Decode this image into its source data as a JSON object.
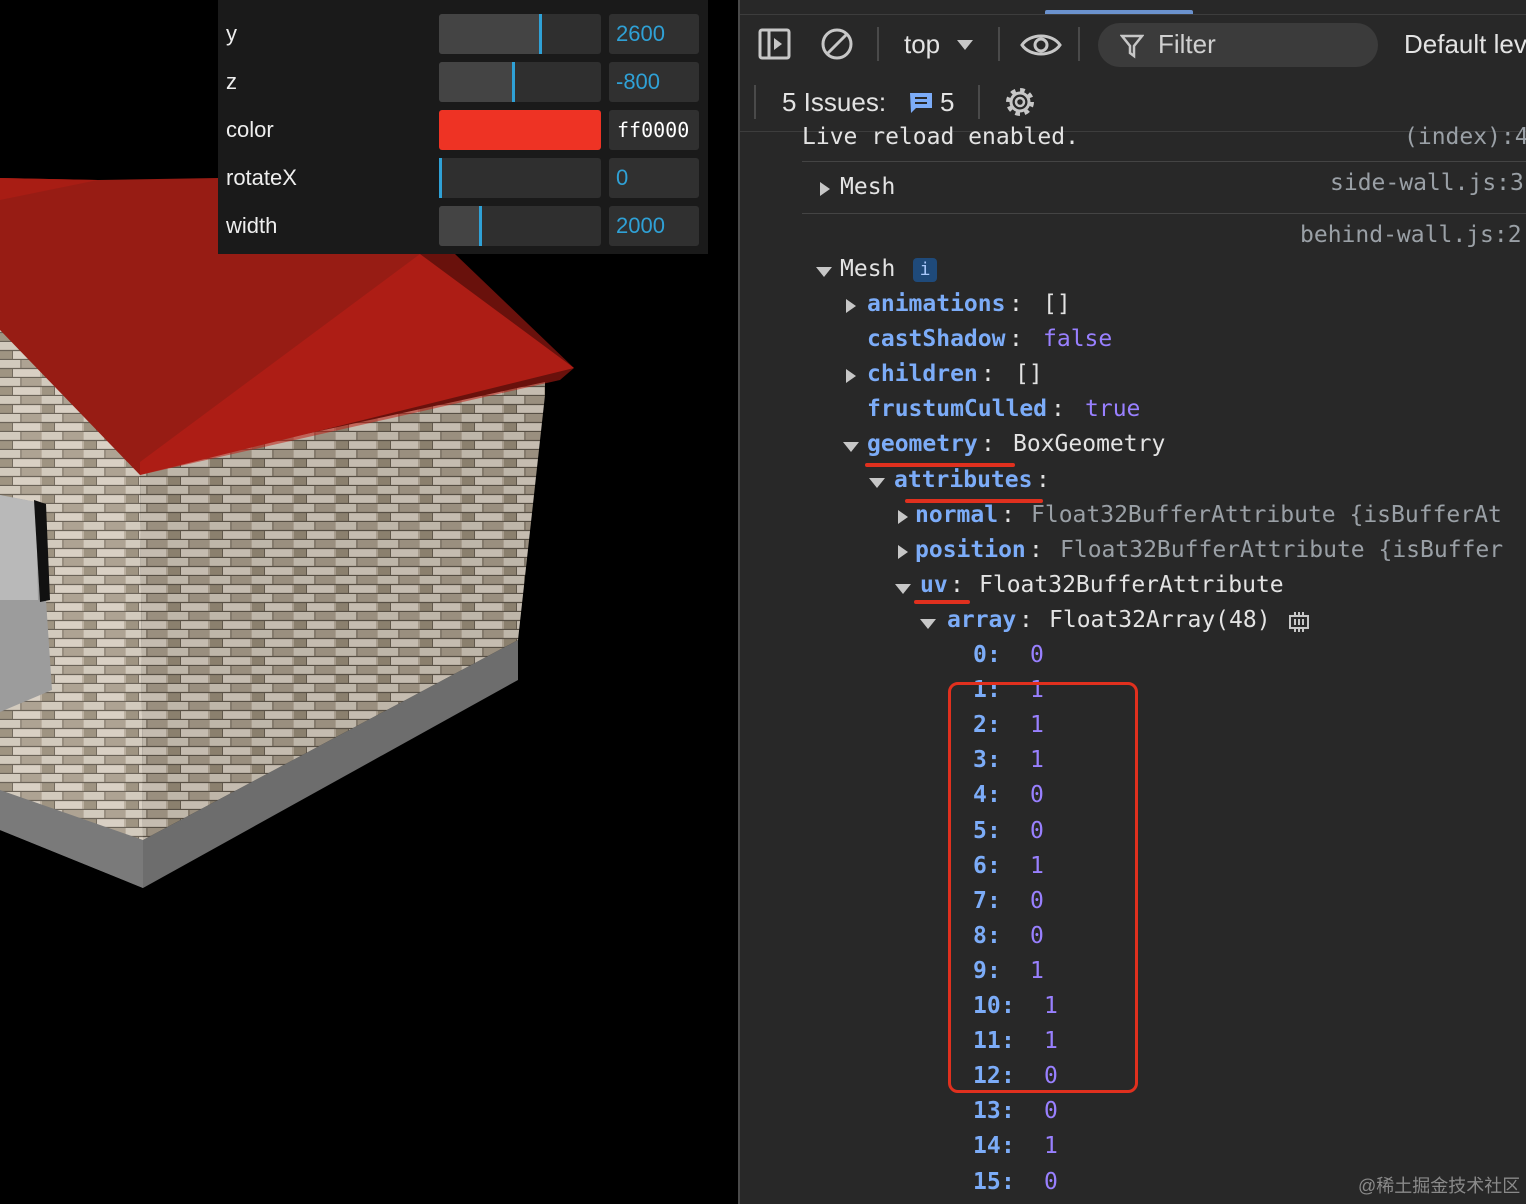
{
  "gui": {
    "rows": [
      {
        "label": "y",
        "value": "2600",
        "fraction": 0.62
      },
      {
        "label": "z",
        "value": "-800",
        "fraction": 0.45
      },
      {
        "label": "color",
        "value": "ff0000",
        "swatch": "#ee3324"
      },
      {
        "label": "rotateX",
        "value": "0",
        "fraction": 0.0
      },
      {
        "label": "width",
        "value": "2000",
        "fraction": 0.25
      }
    ]
  },
  "devtools": {
    "context": "top",
    "filter_placeholder": "Filter",
    "levels_label": "Default lev",
    "issues_label": "5 Issues:",
    "issues_count": "5",
    "log": {
      "reload_text": "Live reload enabled.",
      "reload_src": "(index):4",
      "mesh1_label": "Mesh",
      "mesh1_src": "side-wall.js:3",
      "mesh2_src": "behind-wall.js:2",
      "mesh2_label": "Mesh",
      "info_badge": "i",
      "props": {
        "animations_key": "animations",
        "animations_val": "[]",
        "castShadow_key": "castShadow",
        "castShadow_val": "false",
        "children_key": "children",
        "children_val": "[]",
        "frustumCulled_key": "frustumCulled",
        "frustumCulled_val": "true",
        "geometry_key": "geometry",
        "geometry_val": "BoxGeometry",
        "attributes_key": "attributes",
        "normal_key": "normal",
        "normal_val": "Float32BufferAttribute {isBufferAt",
        "position_key": "position",
        "position_val": "Float32BufferAttribute {isBuffer",
        "uv_key": "uv",
        "uv_val": "Float32BufferAttribute",
        "array_key": "array",
        "array_val": "Float32Array(48)"
      },
      "array_items": [
        {
          "i": "0",
          "v": "0"
        },
        {
          "i": "1",
          "v": "1"
        },
        {
          "i": "2",
          "v": "1"
        },
        {
          "i": "3",
          "v": "1"
        },
        {
          "i": "4",
          "v": "0"
        },
        {
          "i": "5",
          "v": "0"
        },
        {
          "i": "6",
          "v": "1"
        },
        {
          "i": "7",
          "v": "0"
        },
        {
          "i": "8",
          "v": "0"
        },
        {
          "i": "9",
          "v": "1"
        },
        {
          "i": "10",
          "v": "1"
        },
        {
          "i": "11",
          "v": "1"
        },
        {
          "i": "12",
          "v": "0"
        },
        {
          "i": "13",
          "v": "0"
        },
        {
          "i": "14",
          "v": "1"
        },
        {
          "i": "15",
          "v": "0"
        }
      ]
    }
  },
  "watermark": "@稀土掘金技术社区",
  "colors": {
    "accent": "#2fa1d6",
    "annotation": "#e0301e",
    "key": "#7cacf8",
    "value": "#9980ff"
  }
}
